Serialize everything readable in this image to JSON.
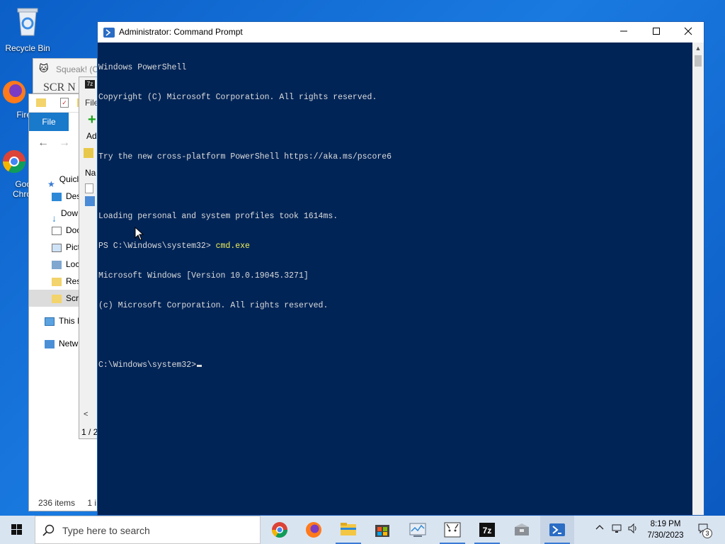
{
  "desktop": {
    "icons": [
      {
        "label": "Recycle Bin"
      },
      {
        "label": "Fire"
      },
      {
        "label": "Goo\nChro"
      }
    ]
  },
  "squeak_window": {
    "title": "Squeak! (C",
    "banner": "SCR N"
  },
  "sevenzip_window": {
    "menu_file": "File",
    "add_label": "Ad",
    "col_name": "Na",
    "status": "1 / 2"
  },
  "explorer": {
    "file_tab": "File",
    "nav_items": [
      {
        "label": "Quicl"
      },
      {
        "label": "Des"
      },
      {
        "label": "Dow"
      },
      {
        "label": "Doc"
      },
      {
        "label": "Pict"
      },
      {
        "label": "Loc"
      },
      {
        "label": "Res"
      },
      {
        "label": "Scra"
      },
      {
        "label": "This I"
      },
      {
        "label": "Netw"
      }
    ],
    "status_count": "236 items",
    "status_sel": "1 i"
  },
  "terminal": {
    "title": "Administrator:  Command Prompt",
    "lines": [
      {
        "text": "Windows PowerShell"
      },
      {
        "text": "Copyright (C) Microsoft Corporation. All rights reserved."
      },
      {
        "text": ""
      },
      {
        "text": "Try the new cross-platform PowerShell https://aka.ms/pscore6"
      },
      {
        "text": ""
      },
      {
        "text": "Loading personal and system profiles took 1614ms."
      }
    ],
    "ps_prompt": "PS C:\\Windows\\system32> ",
    "ps_command": "cmd.exe",
    "lines2": [
      {
        "text": "Microsoft Windows [Version 10.0.19045.3271]"
      },
      {
        "text": "(c) Microsoft Corporation. All rights reserved."
      },
      {
        "text": ""
      }
    ],
    "cmd_prompt": "C:\\Windows\\system32>"
  },
  "taskbar": {
    "search_placeholder": "Type here to search",
    "time": "8:19 PM",
    "date": "7/30/2023",
    "notification_count": "3"
  },
  "colors": {
    "console_bg": "#012456",
    "console_text": "#dcdcdc",
    "command_highlight": "#f2f25a",
    "taskbar_bg": "#d9e4f1",
    "accent": "#1979ca"
  }
}
